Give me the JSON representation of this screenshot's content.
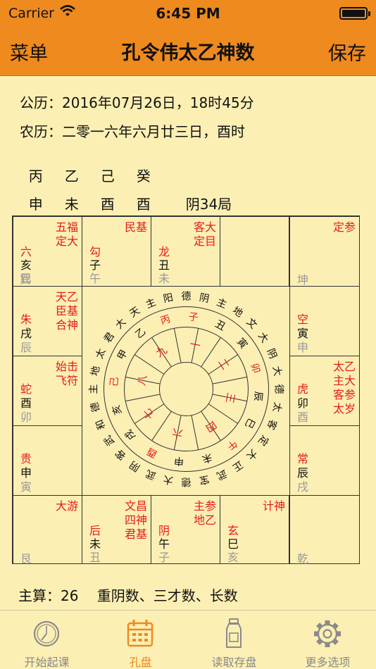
{
  "status": {
    "carrier": "Carrier",
    "time": "6:45 PM"
  },
  "nav": {
    "left": "菜单",
    "title": "孔令伟太乙神数",
    "right": "保存"
  },
  "info": {
    "solar": "公历：2016年07月26日，18时45分",
    "lunar": "农历：二零一六年六月廿三日，酉时",
    "stems": [
      "丙",
      "乙",
      "己",
      "癸"
    ],
    "branches": [
      "申",
      "未",
      "酉",
      "酉"
    ],
    "ju": "阴34局"
  },
  "cells": {
    "xun": {
      "stars": "五福\n定大",
      "god": "六",
      "branch": "亥",
      "palace": "巳",
      "corner": "巽"
    },
    "wu": {
      "stars": "民基",
      "god": "勾",
      "branch": "子",
      "palace": "午"
    },
    "wei": {
      "stars": "客大\n定目",
      "god": "龙",
      "branch": "丑",
      "palace": "未"
    },
    "kun": {
      "stars": "定参",
      "corner": "坤"
    },
    "chen": {
      "stars": "天乙\n臣基\n合神",
      "god": "朱",
      "branch": "戌",
      "palace": "辰"
    },
    "shen": {
      "stars": "",
      "god": "空",
      "branch": "寅",
      "palace": "申"
    },
    "mao": {
      "stars": "始击\n飞符",
      "god": "蛇",
      "branch": "酉",
      "palace": "卯"
    },
    "you": {
      "stars": "太乙\n主大\n客参\n太岁",
      "god": "虎",
      "branch": "卯",
      "palace": "酉"
    },
    "yin": {
      "stars": "",
      "god": "贵",
      "branch": "申",
      "palace": "寅"
    },
    "xu": {
      "stars": "",
      "god": "常",
      "branch": "辰",
      "palace": "戌"
    },
    "gen": {
      "stars": "大游",
      "corner": "艮"
    },
    "chou": {
      "stars": "文昌\n四神\n君基",
      "god": "后",
      "branch": "未",
      "palace": "丑"
    },
    "zi": {
      "stars": "主参\n地乙",
      "god": "阴",
      "branch": "午",
      "palace": "子"
    },
    "hai": {
      "stars": "计神",
      "god": "玄",
      "branch": "巳",
      "palace": "亥"
    },
    "qian": {
      "stars": "",
      "corner": "乾"
    }
  },
  "wheel": {
    "outer": [
      "坤",
      "乾",
      "艮",
      "巽"
    ],
    "ring2": [
      "大阴",
      "大游",
      "天",
      "地",
      "主",
      "客"
    ],
    "ring3": [
      "甲",
      "乙",
      "丙",
      "丁",
      "戊",
      "己",
      "庚",
      "辛",
      "壬",
      "癸",
      "子",
      "丑"
    ],
    "inner": [
      "一",
      "二",
      "三",
      "四",
      "六",
      "七",
      "八",
      "九"
    ],
    "colors": {
      "red": "#e51c1c",
      "black": "#111111"
    }
  },
  "summary": "主算：26　 重阴数、三才数、长数",
  "tabs": [
    {
      "label": "开始起课",
      "icon": "clock-icon"
    },
    {
      "label": "孔盘",
      "icon": "calendar-icon"
    },
    {
      "label": "读取存盘",
      "icon": "bottle-icon"
    },
    {
      "label": "更多选项",
      "icon": "gear-icon"
    }
  ],
  "theme": {
    "accent": "#ee8a1e",
    "background": "#fcefb4",
    "star": "#e51c1c",
    "muted": "#9a9a9a"
  }
}
